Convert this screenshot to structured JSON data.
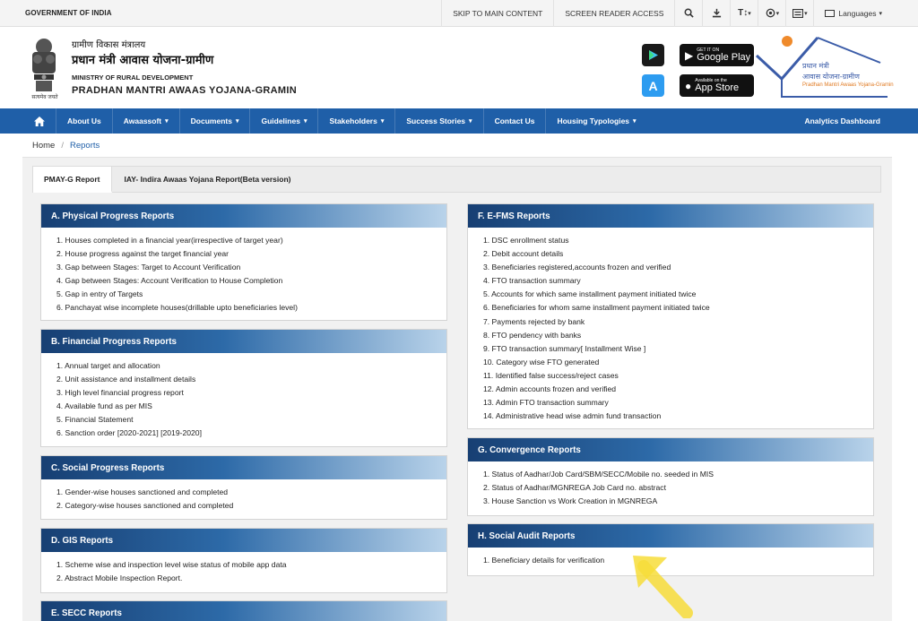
{
  "top_bar": {
    "gov_text": "GOVERNMENT OF INDIA",
    "skip_label": "SKIP TO MAIN CONTENT",
    "screen_reader_label": "SCREEN READER ACCESS",
    "icons": [
      "search-icon",
      "download-icon",
      "text-size-icon",
      "contrast-icon",
      "sitemap-icon"
    ],
    "text_size_glyph": "T↕",
    "languages_label": "Languages"
  },
  "header": {
    "hindi_ministry": "ग्रामीण विकास मंत्रालय",
    "hindi_scheme": "प्रधान मंत्री आवास योजना-ग्रामीण",
    "ministry": "MINISTRY OF RURAL DEVELOPMENT",
    "scheme": "PRADHAN MANTRI AWAAS YOJANA-GRAMIN",
    "emblem_motto": "सत्यमेव जयते",
    "google_play": {
      "small": "GET IT ON",
      "big": "Google Play"
    },
    "app_store": {
      "small": "Available on the",
      "big": "App Store"
    },
    "logo_hindi_1": "प्रधान मंत्री",
    "logo_hindi_2": "आवास योजना-ग्रामीण",
    "logo_english": "Pradhan Mantri Awaas Yojana-Gramin"
  },
  "nav": {
    "items": [
      {
        "label": "About Us",
        "dropdown": false
      },
      {
        "label": "Awaassoft",
        "dropdown": true
      },
      {
        "label": "Documents",
        "dropdown": true
      },
      {
        "label": "Guidelines",
        "dropdown": true
      },
      {
        "label": "Stakeholders",
        "dropdown": true
      },
      {
        "label": "Success Stories",
        "dropdown": true
      },
      {
        "label": "Contact Us",
        "dropdown": false
      },
      {
        "label": "Housing Typologies",
        "dropdown": true
      }
    ],
    "right": "Analytics Dashboard",
    "caret": "▾"
  },
  "breadcrumb": {
    "home": "Home",
    "sep": "/",
    "current": "Reports"
  },
  "tabs": [
    "PMAY-G Report",
    "IAY- Indira Awaas Yojana Report(Beta version)"
  ],
  "panels": {
    "a": {
      "title": "A. Physical Progress Reports",
      "items": [
        "1. Houses completed in a financial year(irrespective of target year)",
        "2. House progress against the target financial year",
        "3. Gap between Stages: Target to Account Verification",
        "4. Gap between Stages: Account Verification to House Completion",
        "5. Gap in entry of Targets",
        "6. Panchayat wise incomplete houses(drillable upto beneficiaries level)"
      ]
    },
    "b": {
      "title": "B. Financial Progress Reports",
      "items": [
        "1. Annual target and allocation",
        "2. Unit assistance and installment details",
        "3. High level financial progress report",
        "4. Available fund as per MIS",
        "5. Financial Statement",
        "6. Sanction order [2020-2021] [2019-2020]"
      ]
    },
    "c": {
      "title": "C. Social Progress Reports",
      "items": [
        "1. Gender-wise houses sanctioned and completed",
        "2. Category-wise houses sanctioned and completed"
      ]
    },
    "d": {
      "title": "D. GIS Reports",
      "items": [
        "1. Scheme wise and inspection level wise status of mobile app data",
        "2. Abstract Mobile Inspection Report."
      ]
    },
    "e": {
      "title": "E. SECC Reports",
      "items": []
    },
    "f": {
      "title": "F. E-FMS Reports",
      "items": [
        "1. DSC enrollment status",
        "2. Debit account details",
        "3. Beneficiaries registered,accounts frozen and verified",
        "4. FTO transaction summary",
        "5. Accounts for which same installment payment initiated twice",
        "6. Beneficiaries for whom same installment payment initiated twice",
        "7. Payments rejected by bank",
        "8. FTO pendency with banks",
        "9. FTO transaction summary[ Installment Wise ]",
        "10. Category wise FTO generated",
        "11. Identified false success/reject cases",
        "12. Admin accounts frozen and verified",
        "13. Admin FTO transaction summary",
        "14. Administrative head wise admin fund transaction"
      ]
    },
    "g": {
      "title": "G. Convergence Reports",
      "items": [
        "1. Status of Aadhar/Job Card/SBM/SECC/Mobile no. seeded in MIS",
        "2. Status of Aadhar/MGNREGA Job Card no. abstract",
        "3. House Sanction vs Work Creation in MGNREGA"
      ]
    },
    "h": {
      "title": "H. Social Audit Reports",
      "items": [
        "1. Beneficiary details for verification"
      ]
    }
  },
  "colors": {
    "nav_blue": "#1f5fa8",
    "panel_header_dark": "#173f73",
    "panel_header_light": "#b9d3ea",
    "annotation_arrow": "#f7dd3a"
  }
}
